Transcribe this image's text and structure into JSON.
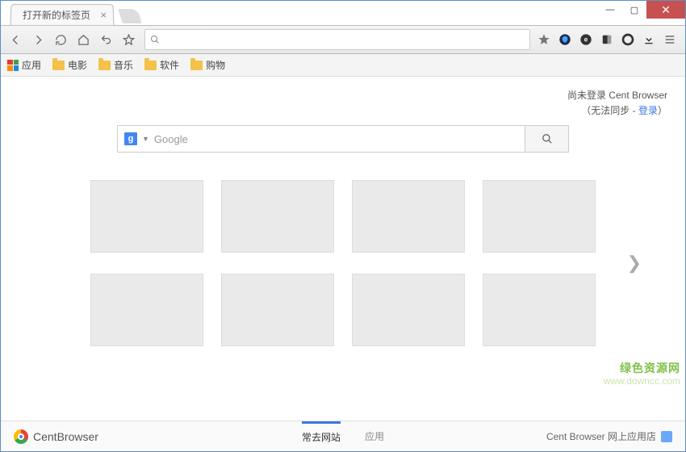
{
  "tab": {
    "title": "打开新的标签页"
  },
  "bookmarks": {
    "apps": "应用",
    "items": [
      "电影",
      "音乐",
      "软件",
      "购物"
    ]
  },
  "signin": {
    "line1": "尚未登录 Cent Browser",
    "prefix": "（无法同步 - ",
    "link": "登录",
    "suffix": "）"
  },
  "search": {
    "engine": "g",
    "placeholder": "Google"
  },
  "footer": {
    "brand": "CentBrowser",
    "tab_active": "常去网站",
    "tab_other": "应用",
    "store": "Cent Browser 网上应用店"
  },
  "watermark": {
    "line1": "绿色资源网",
    "line2": "www.downcc.com"
  }
}
